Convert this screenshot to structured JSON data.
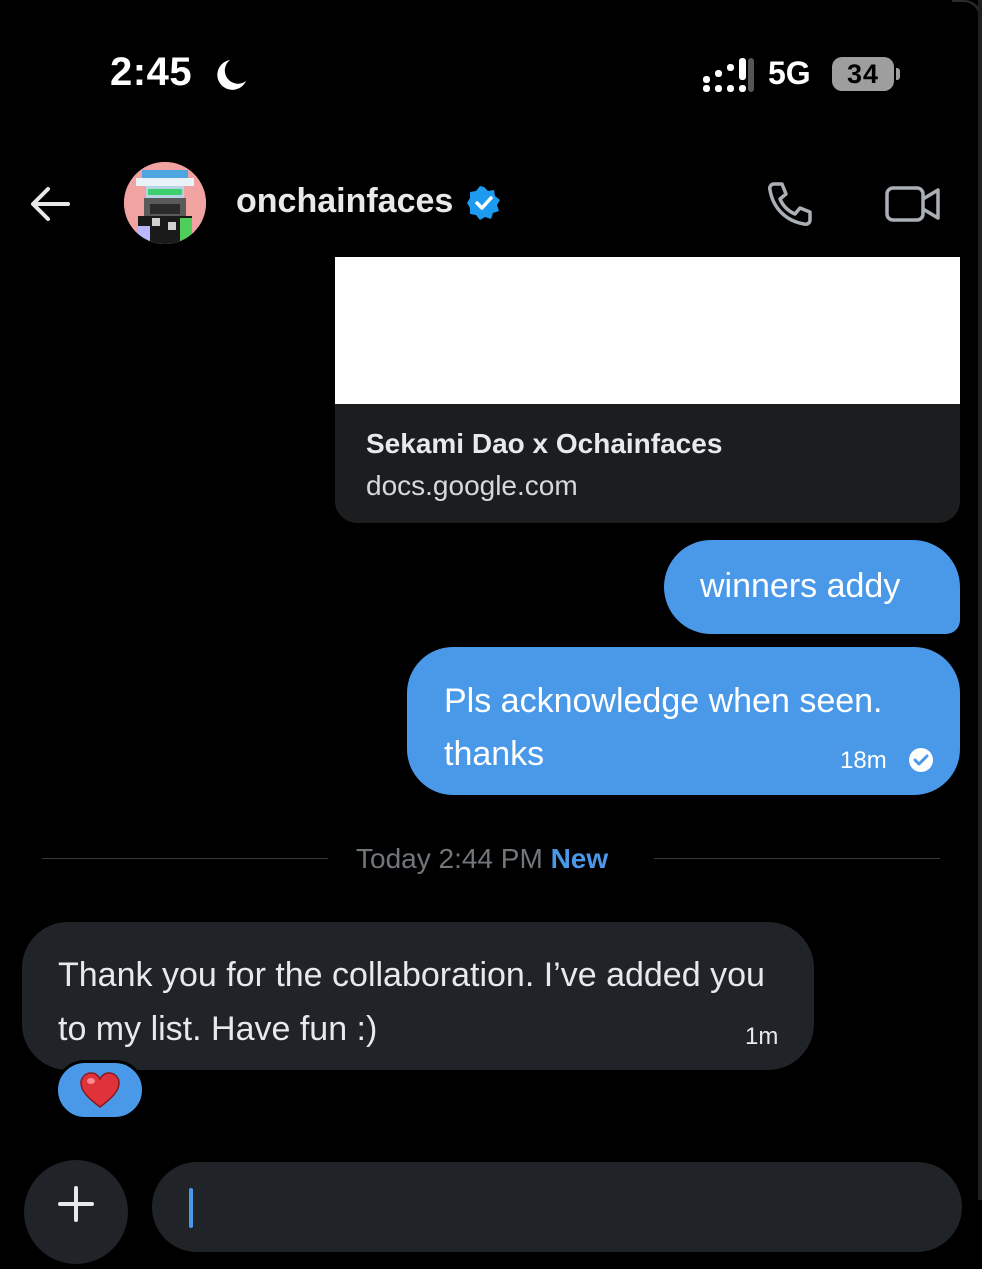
{
  "status_bar": {
    "time": "2:45",
    "network": "5G",
    "battery": "34"
  },
  "header": {
    "contact_name": "onchainfaces"
  },
  "link_card": {
    "title": "Sekami Dao x Ochainfaces",
    "domain": "docs.google.com"
  },
  "messages_out": [
    {
      "text": "winners addy"
    },
    {
      "text": "Pls acknowledge when seen. thanks",
      "time": "18m"
    }
  ],
  "divider": {
    "label": "Today 2:44 PM",
    "new_label": "New"
  },
  "messages_in": [
    {
      "text": "Thank you for the collaboration. I’ve added you to my list. Have fun :)",
      "time": "1m"
    }
  ],
  "reaction": {
    "emoji": "❤️"
  },
  "colors": {
    "accent": "#4a99e9",
    "background": "#000000",
    "incoming_bubble": "#202327"
  },
  "icons": [
    "moon-icon",
    "signal-icon",
    "back-arrow-icon",
    "verified-badge-icon",
    "phone-icon",
    "video-camera-icon",
    "read-check-icon",
    "heart-icon",
    "plus-icon"
  ]
}
